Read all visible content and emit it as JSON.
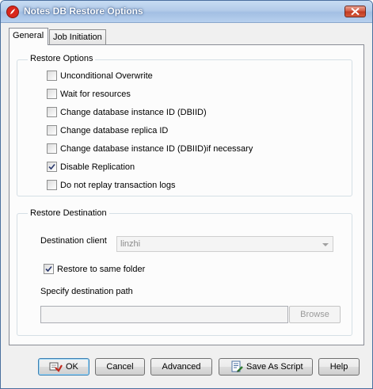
{
  "window": {
    "title": "Notes DB Restore Options"
  },
  "tabs": [
    {
      "label": "General",
      "active": true
    },
    {
      "label": "Job Initiation",
      "active": false
    }
  ],
  "restore_options": {
    "group_label": "Restore Options",
    "items": [
      {
        "label": "Unconditional Overwrite",
        "checked": false
      },
      {
        "label": "Wait for resources",
        "checked": false
      },
      {
        "label": "Change database instance ID (DBIID)",
        "checked": false
      },
      {
        "label": "Change database replica ID",
        "checked": false
      },
      {
        "label": "Change database instance ID (DBIID)if necessary",
        "checked": false
      },
      {
        "label": "Disable Replication",
        "checked": true
      },
      {
        "label": "Do not replay transaction logs",
        "checked": false
      }
    ]
  },
  "restore_destination": {
    "group_label": "Restore Destination",
    "destination_client_label": "Destination client",
    "destination_client_value": "linzhi",
    "same_folder_label": "Restore to same folder",
    "same_folder_checked": true,
    "path_label": "Specify destination path",
    "path_value": "",
    "browse_label": "Browse"
  },
  "buttons": {
    "ok": "OK",
    "cancel": "Cancel",
    "advanced": "Advanced",
    "save_script": "Save As Script",
    "help": "Help"
  },
  "colors": {
    "title_bar": "#b3cbe9",
    "close_button": "#c0381e",
    "checkmark": "#2b3a6e"
  }
}
